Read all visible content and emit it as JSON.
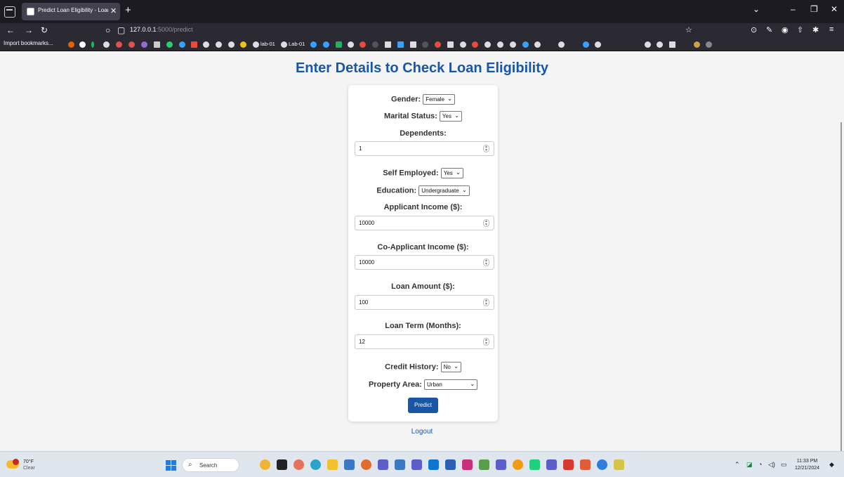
{
  "browser": {
    "tab_title": "Predict Loan Eligibility - Loan Eligibi",
    "url_host": "127.0.0.1",
    "url_path": ":5000/predict",
    "import_bookmarks_label": "Import bookmarks...",
    "bookmark_labels": [
      "lab-01",
      "Lab-01"
    ]
  },
  "page": {
    "title": "Enter Details to Check Loan Eligibility",
    "logout_label": "Logout",
    "predict_label": "Predict"
  },
  "form": {
    "gender": {
      "label": "Gender:",
      "value": "Female"
    },
    "marital": {
      "label": "Marital Status:",
      "value": "Yes"
    },
    "dependents": {
      "label": "Dependents:",
      "value": "1"
    },
    "self_employed": {
      "label": "Self Employed:",
      "value": "Yes"
    },
    "education": {
      "label": "Education:",
      "value": "Undergraduate"
    },
    "applicant_income": {
      "label": "Applicant Income ($):",
      "value": "10000"
    },
    "coapplicant_income": {
      "label": "Co-Applicant Income ($):",
      "value": "10000"
    },
    "loan_amount": {
      "label": "Loan Amount ($):",
      "value": "100"
    },
    "loan_term": {
      "label": "Loan Term (Months):",
      "value": "12"
    },
    "credit_history": {
      "label": "Credit History:",
      "value": "No"
    },
    "property_area": {
      "label": "Property Area:",
      "value": "Urban"
    }
  },
  "taskbar": {
    "weather_temp": "70°F",
    "weather_cond": "Clear",
    "search_label": "Search",
    "time": "11:33 PM",
    "date": "12/21/2024"
  },
  "colors": {
    "accent": "#1a56a6",
    "page_bg": "#f4f4f4",
    "browser_chrome": "#2b2a33"
  }
}
